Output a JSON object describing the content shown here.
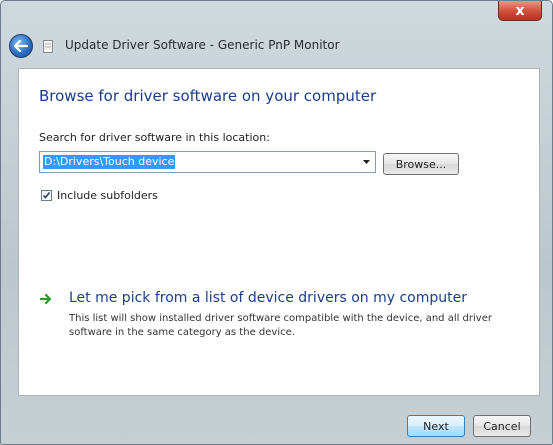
{
  "window": {
    "title": "Update Driver Software - Generic PnP Monitor",
    "close_glyph": "x"
  },
  "icons": {
    "back": "back-arrow-icon",
    "dialog": "driver-document-icon",
    "arrow": "green-arrow-icon",
    "dropdown": "chevron-down-icon",
    "check": "checkmark-icon"
  },
  "main": {
    "heading": "Browse for driver software on your computer",
    "search_label": "Search for driver software in this location:",
    "path_value": "D:\\Drivers\\Touch device",
    "browse_label": "Browse...",
    "include_subfolders_label": "Include subfolders",
    "include_subfolders_checked": true
  },
  "pick_option": {
    "heading": "Let me pick from a list of device drivers on my computer",
    "description": "This list will show installed driver software compatible with the device, and all driver software in the same category as the device."
  },
  "footer": {
    "next_label": "Next",
    "cancel_label": "Cancel"
  },
  "colors": {
    "heading_blue": "#1a3e8c",
    "selection_blue": "#3399ff",
    "arrow_green": "#2e9a2e",
    "close_red": "#c8412f"
  }
}
